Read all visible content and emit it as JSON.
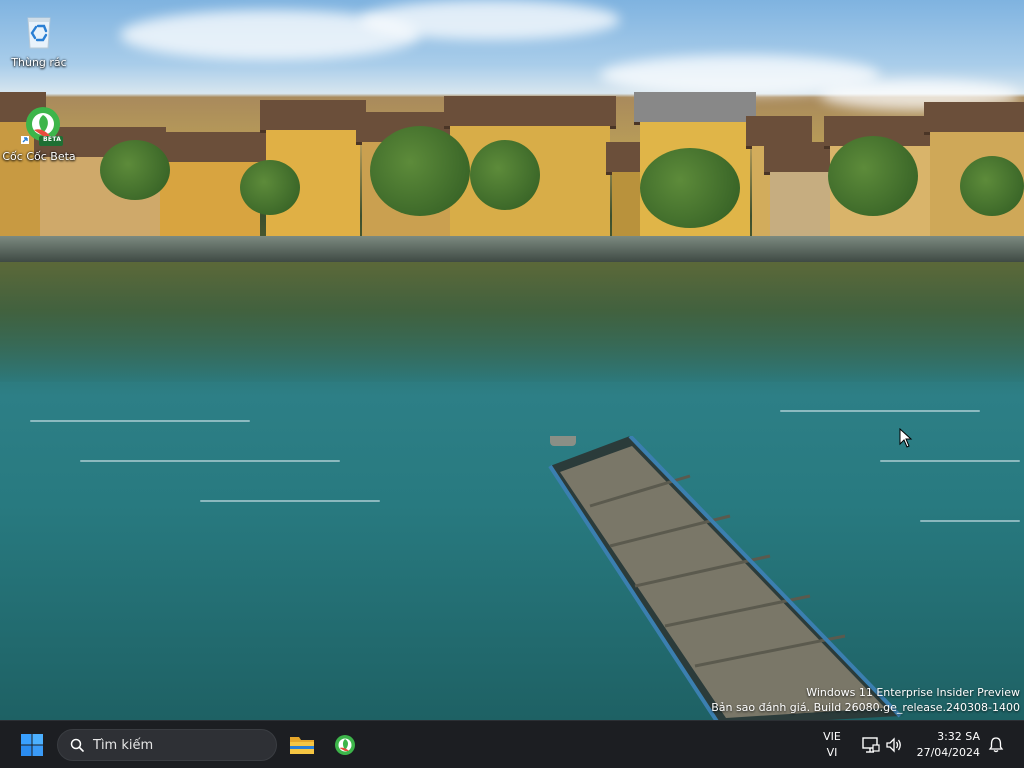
{
  "desktop": {
    "icons": [
      {
        "label": "Thùng rác",
        "icon": "recycle-bin-icon"
      },
      {
        "label": "Cốc Cốc Beta",
        "icon": "coccoc-beta-icon",
        "badge": "BETA"
      }
    ],
    "watermark": {
      "line1": "Windows 11 Enterprise Insider Preview",
      "line2": "Bản sao đánh giá. Build 26080.ge_release.240308-1400"
    }
  },
  "taskbar": {
    "search_placeholder": "Tìm kiếm",
    "pinned": [
      {
        "name": "file-explorer",
        "icon": "folder-icon"
      },
      {
        "name": "coccoc",
        "icon": "coccoc-icon"
      }
    ],
    "tray": {
      "lang_top": "VIE",
      "lang_bottom": "VI",
      "time": "3:32 SA",
      "date": "27/04/2024"
    }
  },
  "colors": {
    "taskbar_bg": "#1c1e22",
    "start_blue": "#2f8fff",
    "coccoc_green": "#3db54a",
    "folder_yellow": "#f5c542"
  }
}
